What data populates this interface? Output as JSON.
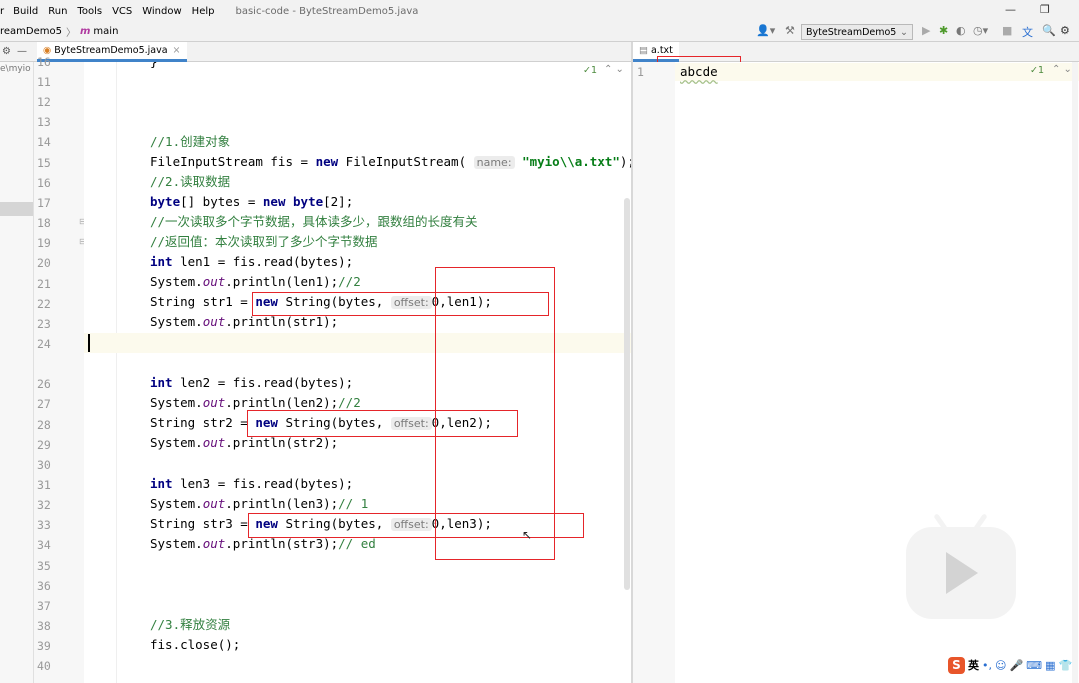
{
  "menu": {
    "items": [
      "r",
      "Build",
      "Run",
      "Tools",
      "VCS",
      "Window",
      "Help"
    ],
    "title": "basic-code - ByteStreamDemo5.java"
  },
  "nav": {
    "crumbs": [
      "reamDemo5",
      "main"
    ]
  },
  "toolbar": {
    "run_config": "ByteStreamDemo5"
  },
  "tabs": {
    "left_tab": "ByteStreamDemo5.java",
    "right_tab": "a.txt"
  },
  "project_path": "e\\myio",
  "editor": {
    "top_partial_line": "16",
    "line_numbers": [
      "11",
      "12",
      "13",
      "14",
      "15",
      "16",
      "17",
      "18",
      "19",
      "20",
      "21",
      "22",
      "23",
      "24",
      "",
      "26",
      "27",
      "28",
      "29",
      "30",
      "31",
      "32",
      "33",
      "34",
      "35",
      "36",
      "37",
      "38",
      "39",
      "40"
    ],
    "comments": {
      "c1": "//1.创建对象",
      "c2": "//2.读取数据",
      "c3": "//一次读取多个字节数据，具体读多少，跟数组的长度有关",
      "c4": "//返回值：本次读取到了多少个字节数据",
      "c5": "//3.释放资源",
      "t2": "//2",
      "t2b": "//2",
      "t1": "// 1",
      "ted": "// ed"
    },
    "keywords": {
      "new": "new",
      "byte": "byte",
      "int": "int"
    },
    "hints": {
      "name": "name:",
      "offset": "offset:"
    },
    "idents": {
      "fis_decl": "FileInputStream fis = ",
      "fis_ctor": " FileInputStream(",
      "path": "\"myio\\\\a.txt\"",
      "close_paren": ");",
      "bytes_decl": "[] bytes = ",
      "byte2": "[2];",
      "len1_decl": " len1 = fis.read(bytes);",
      "len2_decl": " len2 = fis.read(bytes);",
      "len3_decl": " len3 = fis.read(bytes);",
      "sys": "System.",
      "out": "out",
      "println_len1": ".println(len1);",
      "println_len2": ".println(len2);",
      "println_len3": ".println(len3);",
      "println_str1": ".println(str1);",
      "println_str2": ".println(str2);",
      "println_str3": ".println(str3);",
      "str1_decl": "String str1 = ",
      "str2_decl": "String str2 = ",
      "str3_decl": "String str3 = ",
      "string_ctor": " String(bytes, ",
      "zero": "0",
      "len1_end": ",len1);",
      "len2_end": ",len2);",
      "len3_end": ",len3);",
      "close": "fis.close();"
    },
    "inspection_count": "1"
  },
  "right_editor": {
    "line_number": "1",
    "content": "abcde",
    "inspection_count": "1"
  },
  "ime": {
    "label": "英"
  },
  "colors": {
    "comment": "#338040",
    "keyword": "#000080",
    "string": "#067d17",
    "static_field": "#660e7a",
    "annotation_box": "#e5252a",
    "active_tab_underline": "#4083c9"
  }
}
